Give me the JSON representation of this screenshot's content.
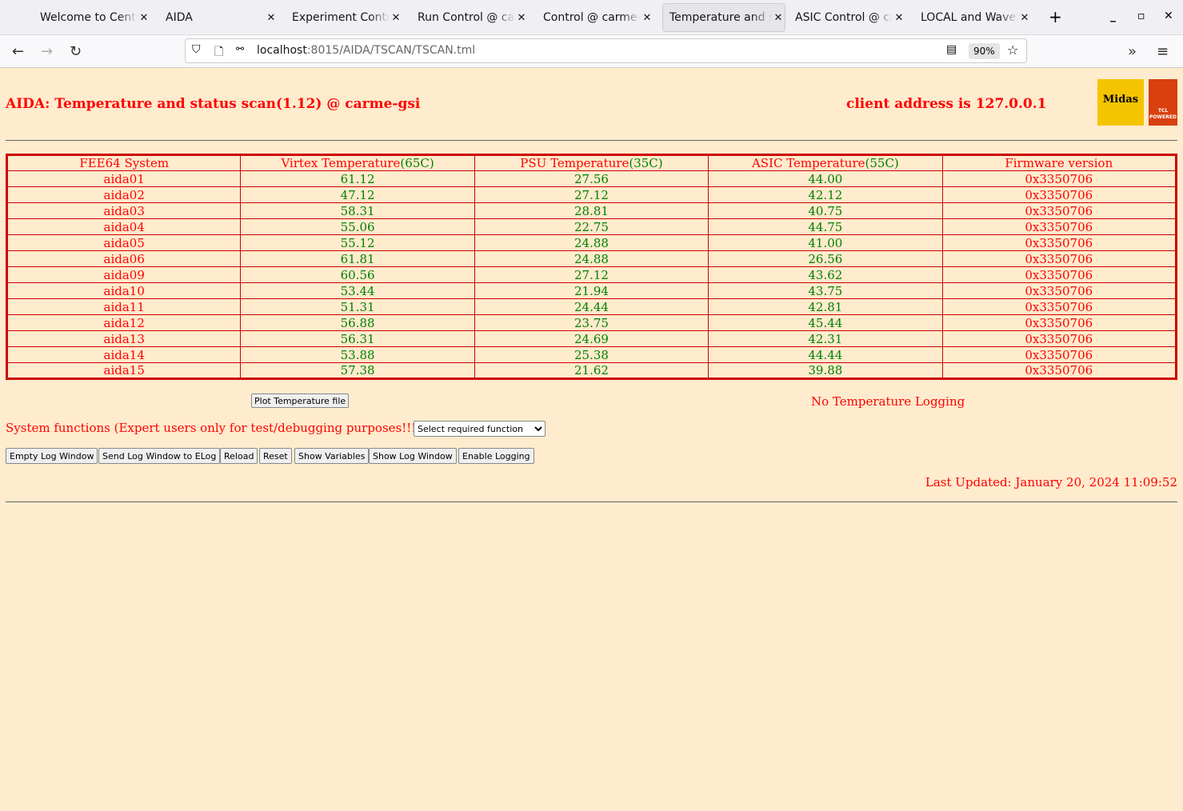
{
  "browser": {
    "tabs": [
      {
        "title": "Welcome to CentOS"
      },
      {
        "title": "AIDA"
      },
      {
        "title": "Experiment Control"
      },
      {
        "title": "Run Control @ carme-gsi"
      },
      {
        "title": "Control @ carme-gsi"
      },
      {
        "title": "Temperature and status"
      },
      {
        "title": "ASIC Control @ carme-gsi"
      },
      {
        "title": "LOCAL and Waveform"
      }
    ],
    "url_host": "localhost",
    "url_path": ":8015/AIDA/TSCAN/TSCAN.tml",
    "zoom": "90%"
  },
  "header": {
    "title": "AIDA: Temperature and status scan(1.12) @ carme-gsi",
    "client": "client address is 127.0.0.1",
    "logo1": "Midas",
    "logo2": "TCL POWERED"
  },
  "table": {
    "headers": [
      {
        "text": "FEE64 System",
        "limit": ""
      },
      {
        "text": "Virtex Temperature",
        "limit": "(65C)"
      },
      {
        "text": "PSU Temperature",
        "limit": "(35C)"
      },
      {
        "text": "ASIC Temperature",
        "limit": "(55C)"
      },
      {
        "text": "Firmware version",
        "limit": ""
      }
    ],
    "rows": [
      [
        "aida01",
        "61.12",
        "27.56",
        "44.00",
        "0x3350706"
      ],
      [
        "aida02",
        "47.12",
        "27.12",
        "42.12",
        "0x3350706"
      ],
      [
        "aida03",
        "58.31",
        "28.81",
        "40.75",
        "0x3350706"
      ],
      [
        "aida04",
        "55.06",
        "22.75",
        "44.75",
        "0x3350706"
      ],
      [
        "aida05",
        "55.12",
        "24.88",
        "41.00",
        "0x3350706"
      ],
      [
        "aida06",
        "61.81",
        "24.88",
        "26.56",
        "0x3350706"
      ],
      [
        "aida09",
        "60.56",
        "27.12",
        "43.62",
        "0x3350706"
      ],
      [
        "aida10",
        "53.44",
        "21.94",
        "43.75",
        "0x3350706"
      ],
      [
        "aida11",
        "51.31",
        "24.44",
        "42.81",
        "0x3350706"
      ],
      [
        "aida12",
        "56.88",
        "23.75",
        "45.44",
        "0x3350706"
      ],
      [
        "aida13",
        "56.31",
        "24.69",
        "42.31",
        "0x3350706"
      ],
      [
        "aida14",
        "53.88",
        "25.38",
        "44.44",
        "0x3350706"
      ],
      [
        "aida15",
        "57.38",
        "21.62",
        "39.88",
        "0x3350706"
      ]
    ]
  },
  "plot_button": "Plot Temperature file",
  "logging_status": "No Temperature Logging",
  "system_functions_label": "System functions (Expert users only for test/debugging purposes!!!)",
  "select_value": "Select required function",
  "buttons": [
    "Empty Log Window",
    "Send Log Window to ELog",
    "Reload",
    "Reset",
    "Show Variables",
    "Show Log Window",
    "Enable Logging"
  ],
  "last_updated": "Last Updated: January 20, 2024 11:09:52"
}
